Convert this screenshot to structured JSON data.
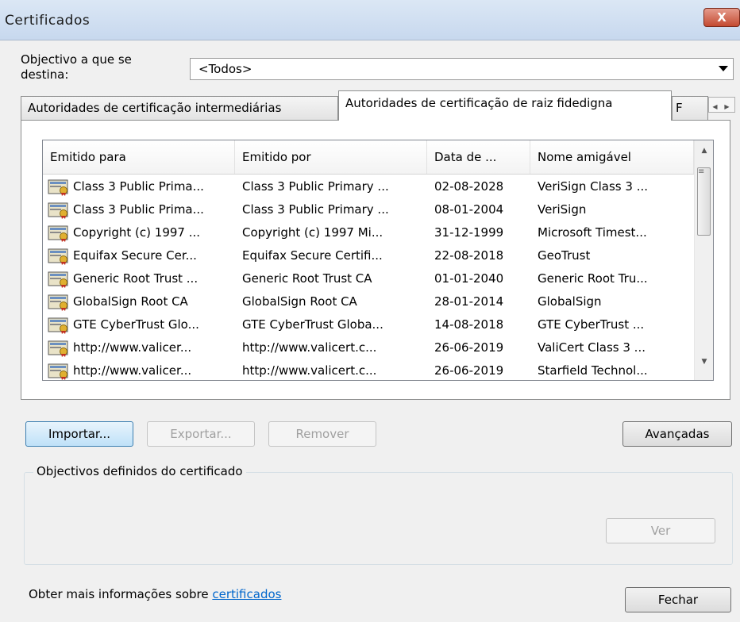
{
  "window": {
    "title": "Certificados",
    "close_glyph": "X"
  },
  "purpose": {
    "label_line1": "Objectivo a que se",
    "label_line2": "destina:",
    "selected": "<Todos>"
  },
  "tabs": [
    {
      "label": "Autoridades de certificação intermediárias"
    },
    {
      "label": "Autoridades de certificação de raiz fidedigna"
    },
    {
      "label": "F"
    }
  ],
  "list": {
    "columns": [
      "Emitido para",
      "Emitido por",
      "Data de ...",
      "Nome amigável"
    ],
    "rows": [
      [
        "Class 3 Public Prima...",
        "Class 3 Public Primary ...",
        "02-08-2028",
        "VeriSign Class 3 ..."
      ],
      [
        "Class 3 Public Prima...",
        "Class 3 Public Primary ...",
        "08-01-2004",
        "VeriSign"
      ],
      [
        "Copyright (c) 1997 ...",
        "Copyright (c) 1997 Mi...",
        "31-12-1999",
        "Microsoft Timest..."
      ],
      [
        "Equifax Secure Cer...",
        "Equifax Secure Certifi...",
        "22-08-2018",
        "GeoTrust"
      ],
      [
        "Generic Root Trust ...",
        "Generic Root Trust CA",
        "01-01-2040",
        "Generic Root Tru..."
      ],
      [
        "GlobalSign Root CA",
        "GlobalSign Root CA",
        "28-01-2014",
        "GlobalSign"
      ],
      [
        "GTE CyberTrust Glo...",
        "GTE CyberTrust Globa...",
        "14-08-2018",
        "GTE CyberTrust ..."
      ],
      [
        "http://www.valicer...",
        "http://www.valicert.c...",
        "26-06-2019",
        "ValiCert Class 3 ..."
      ],
      [
        "http://www.valicer...",
        "http://www.valicert.c...",
        "26-06-2019",
        "Starfield Technol..."
      ]
    ]
  },
  "buttons": {
    "import": "Importar...",
    "export": "Exportar...",
    "remove": "Remover",
    "advanced": "Avançadas",
    "view": "Ver",
    "close": "Fechar"
  },
  "group": {
    "title": "Objectivos definidos do certificado"
  },
  "footer": {
    "text": "Obter mais informações sobre ",
    "link": "certificados"
  },
  "colors": {
    "link": "#0066cc",
    "close_button": "#c44a31",
    "default_button": "#bfe1f8"
  }
}
